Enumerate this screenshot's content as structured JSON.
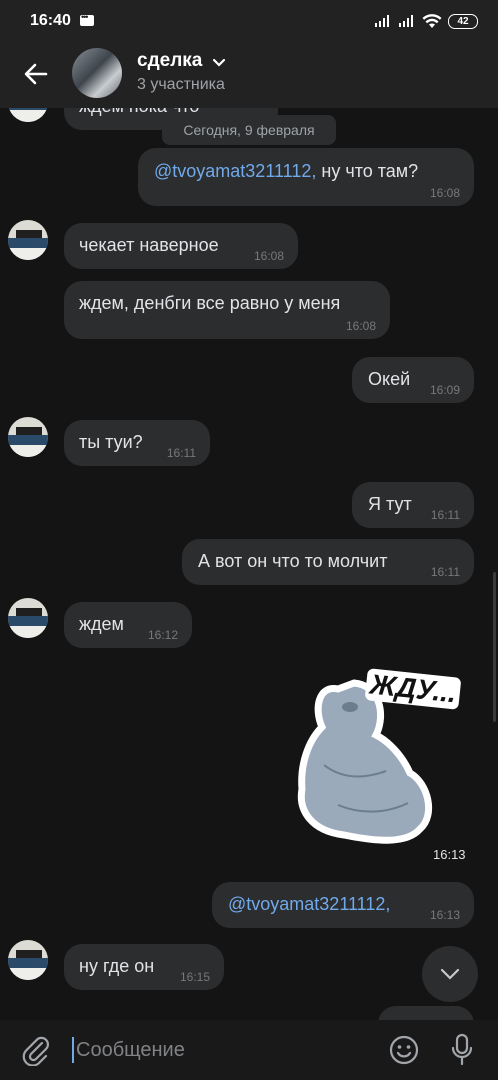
{
  "status_bar": {
    "time": "16:40",
    "battery": "42"
  },
  "header": {
    "title": "сделка",
    "subtitle": "3 участника"
  },
  "partial_top_message": {
    "text": "ждем пока что"
  },
  "date_separator": "Сегодня, 9 февраля",
  "messages": [
    {
      "side": "out",
      "mention": "@tvoyamat3211112,",
      "text": "  ну что там?",
      "time": "16:08"
    },
    {
      "side": "in",
      "text": "чекает наверное",
      "time": "16:08"
    },
    {
      "side": "in",
      "text": "ждем, денбги все равно у меня",
      "time": "16:08"
    },
    {
      "side": "out",
      "text": "Окей",
      "time": "16:09"
    },
    {
      "side": "in",
      "text": "ты туи?",
      "time": "16:11"
    },
    {
      "side": "out",
      "text": "Я тут",
      "time": "16:11"
    },
    {
      "side": "out",
      "text": "А вот он что то молчит",
      "time": "16:11"
    },
    {
      "side": "in",
      "text": "ждем",
      "time": "16:12"
    },
    {
      "side": "out",
      "sticker_caption": "ЖДУ...",
      "time": "16:13"
    },
    {
      "side": "out",
      "mention": "@tvoyamat3211112,",
      "text": "",
      "time": "16:13"
    },
    {
      "side": "in",
      "text": "ну где он",
      "time": "16:15"
    }
  ],
  "composer": {
    "placeholder": "Сообщение"
  },
  "colors": {
    "background": "#141414",
    "bubble": "#2c2d2e",
    "accent": "#71aaeb"
  }
}
